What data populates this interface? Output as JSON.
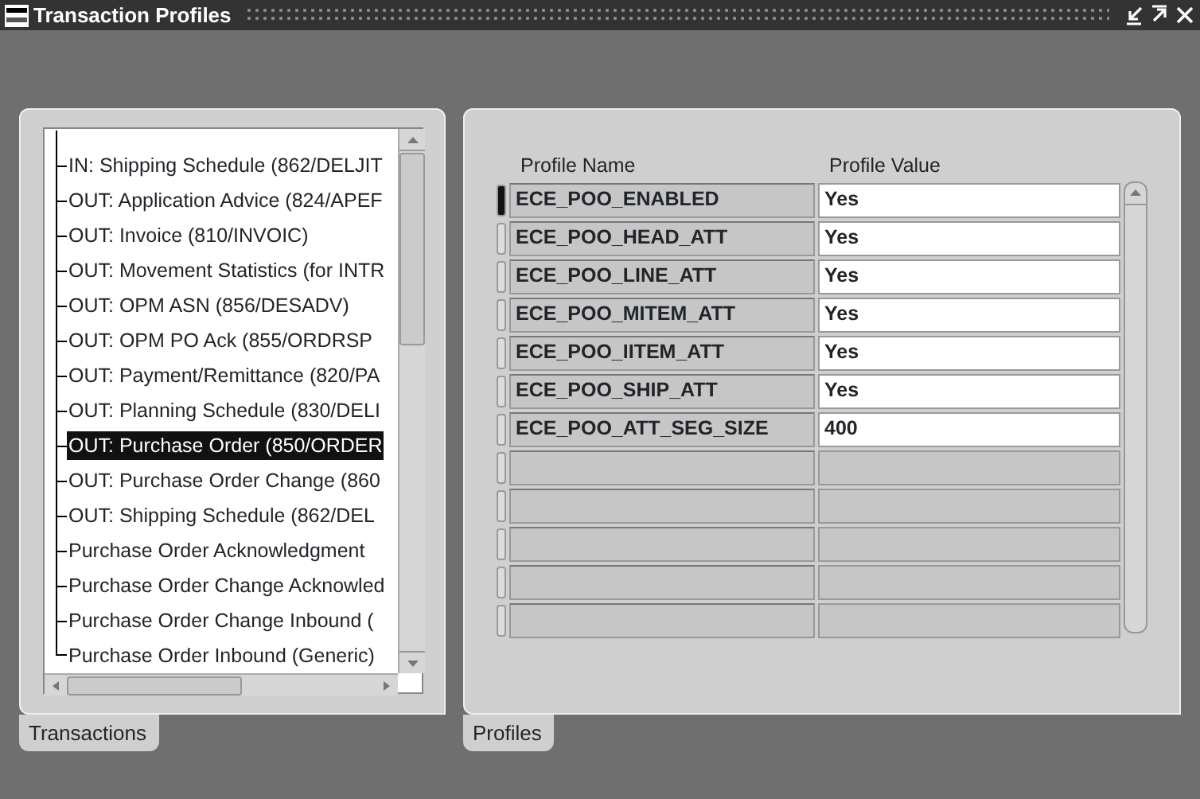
{
  "window": {
    "title": "Transaction Profiles"
  },
  "transactions": {
    "tab": "Transactions",
    "items": [
      {
        "label": "IN: Shipping Schedule (862/DELJIT",
        "selected": false
      },
      {
        "label": "OUT: Application Advice (824/APEF",
        "selected": false
      },
      {
        "label": "OUT: Invoice (810/INVOIC)",
        "selected": false
      },
      {
        "label": "OUT: Movement Statistics (for INTR",
        "selected": false
      },
      {
        "label": "OUT: OPM ASN (856/DESADV)",
        "selected": false
      },
      {
        "label": "OUT: OPM PO Ack (855/ORDRSP",
        "selected": false
      },
      {
        "label": "OUT: Payment/Remittance (820/PA",
        "selected": false
      },
      {
        "label": "OUT: Planning Schedule (830/DELI",
        "selected": false
      },
      {
        "label": "OUT: Purchase Order (850/ORDER",
        "selected": true
      },
      {
        "label": "OUT: Purchase Order Change (860",
        "selected": false
      },
      {
        "label": "OUT: Shipping Schedule (862/DEL",
        "selected": false
      },
      {
        "label": "Purchase Order Acknowledgment",
        "selected": false
      },
      {
        "label": "Purchase Order Change Acknowled",
        "selected": false
      },
      {
        "label": "Purchase Order Change Inbound (",
        "selected": false
      },
      {
        "label": "Purchase Order Inbound (Generic)",
        "selected": false
      }
    ]
  },
  "profiles": {
    "tab": "Profiles",
    "columns": [
      "Profile Name",
      "Profile Value"
    ],
    "rows": [
      {
        "name": "ECE_POO_ENABLED",
        "value": "Yes",
        "selected": true
      },
      {
        "name": "ECE_POO_HEAD_ATT",
        "value": "Yes",
        "selected": false
      },
      {
        "name": "ECE_POO_LINE_ATT",
        "value": "Yes",
        "selected": false
      },
      {
        "name": "ECE_POO_MITEM_ATT",
        "value": "Yes",
        "selected": false
      },
      {
        "name": "ECE_POO_IITEM_ATT",
        "value": "Yes",
        "selected": false
      },
      {
        "name": "ECE_POO_SHIP_ATT",
        "value": "Yes",
        "selected": false
      },
      {
        "name": "ECE_POO_ATT_SEG_SIZE",
        "value": "400",
        "selected": false
      },
      {
        "name": null,
        "value": null,
        "selected": false
      },
      {
        "name": null,
        "value": null,
        "selected": false
      },
      {
        "name": null,
        "value": null,
        "selected": false
      },
      {
        "name": null,
        "value": null,
        "selected": false
      },
      {
        "name": null,
        "value": null,
        "selected": false
      }
    ]
  }
}
